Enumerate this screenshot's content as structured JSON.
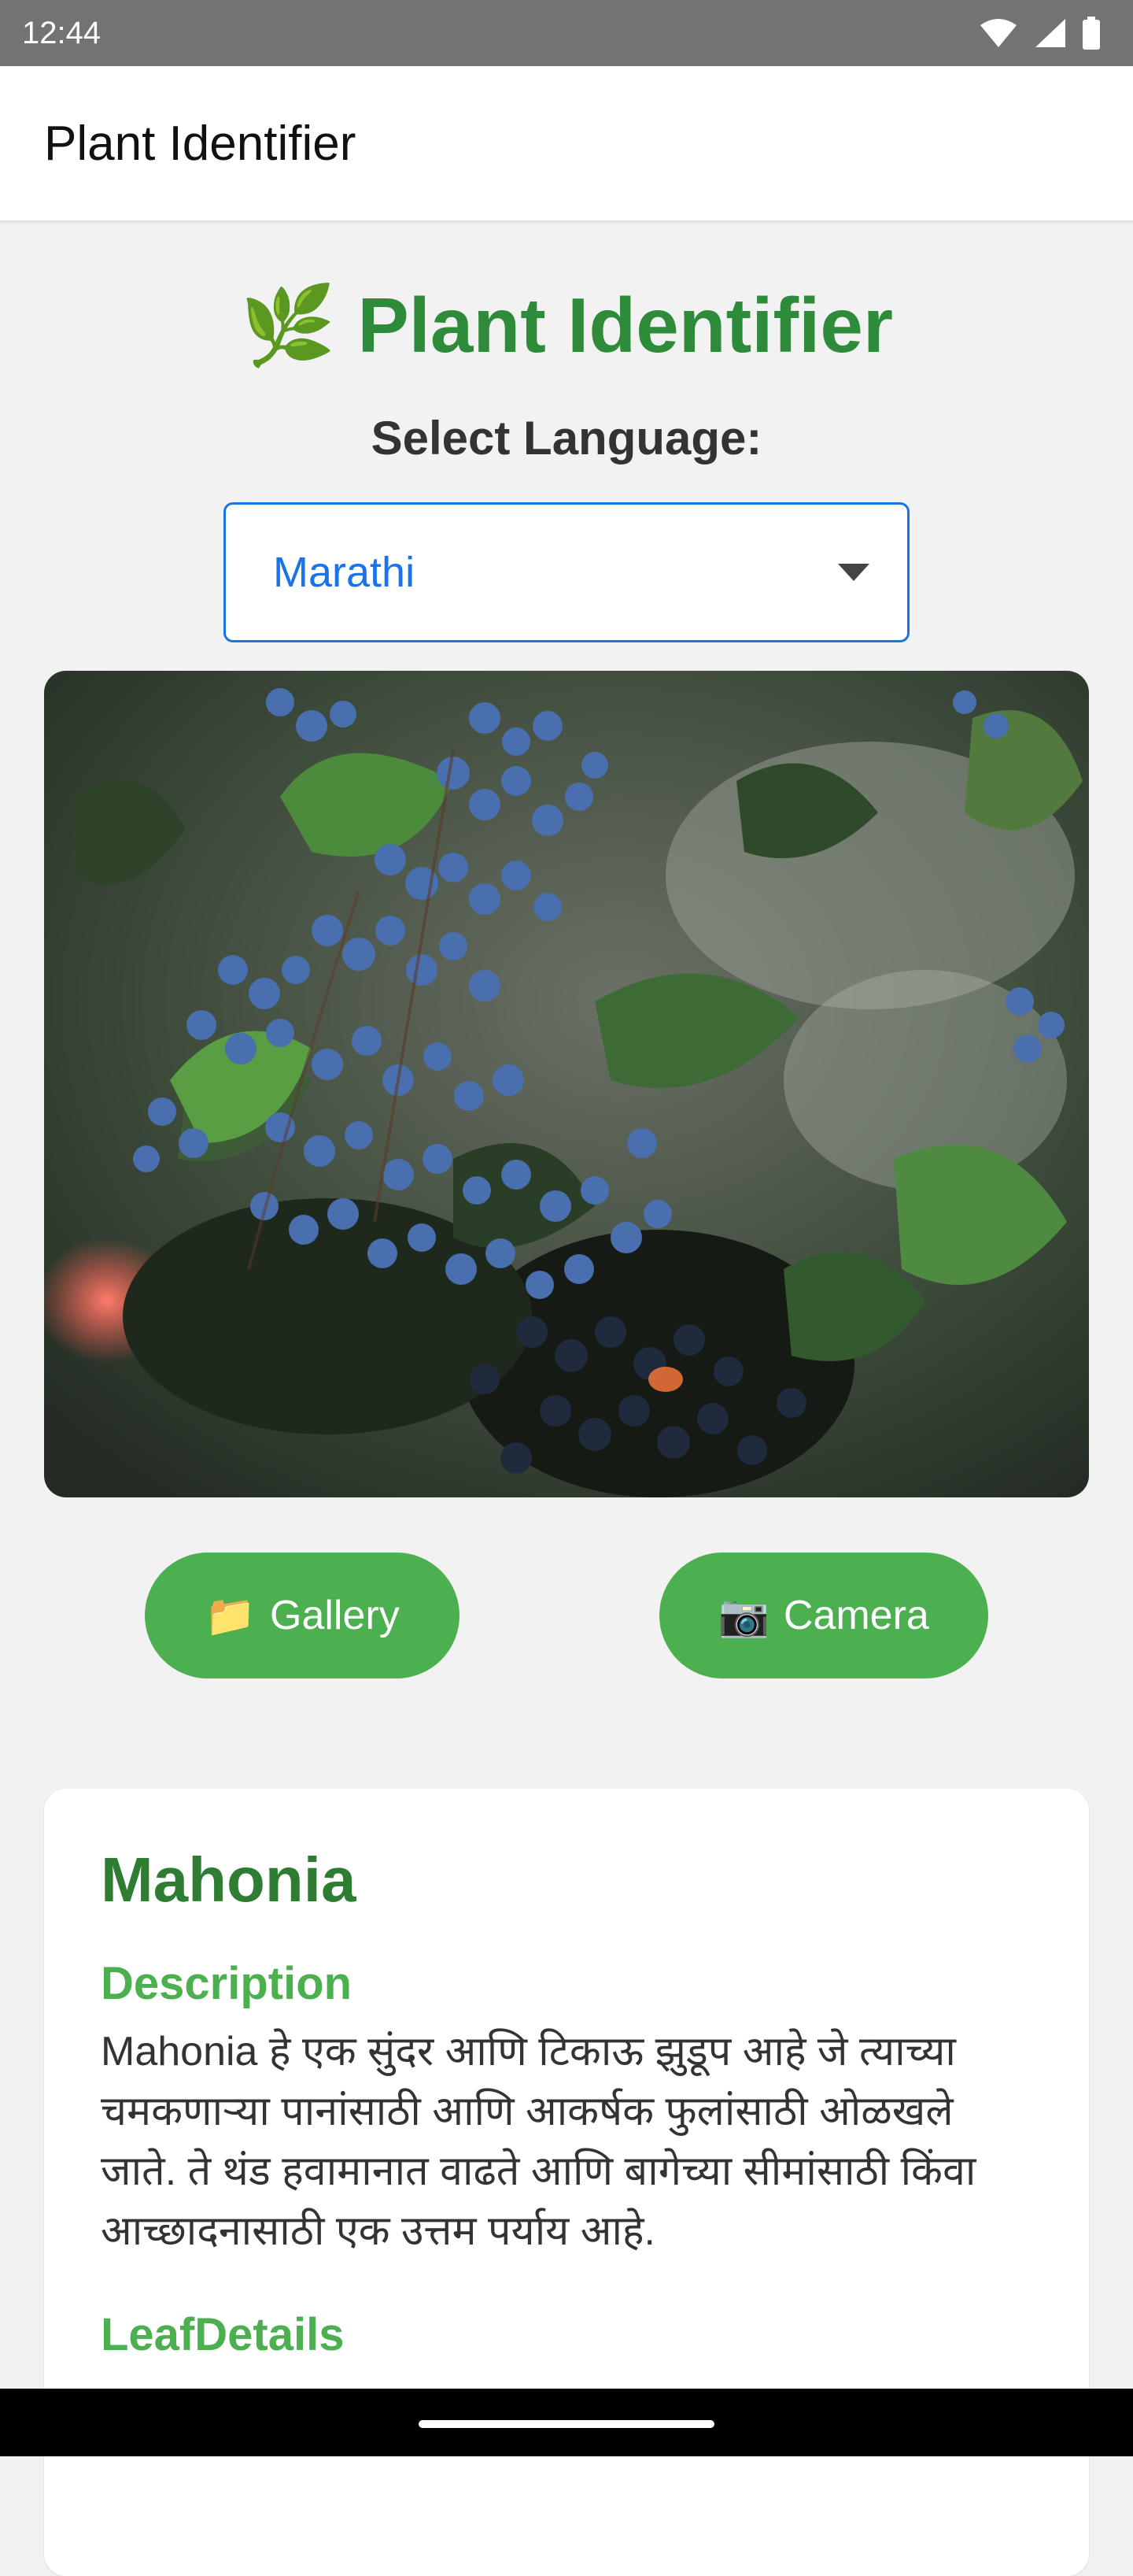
{
  "status_bar": {
    "time": "12:44"
  },
  "app_bar": {
    "title": "Plant Identifier"
  },
  "header": {
    "icon_glyph": "🌿",
    "title": "Plant Identifier"
  },
  "language": {
    "label": "Select Language:",
    "selected": "Marathi"
  },
  "photo": {
    "subject": "Mahonia shrub with clusters of blue berries and holly-like leaves"
  },
  "buttons": {
    "gallery": {
      "icon_glyph": "📁",
      "label": "Gallery"
    },
    "camera": {
      "icon_glyph": "📷",
      "label": "Camera"
    }
  },
  "result": {
    "plant_name": "Mahonia",
    "description_heading": "Description",
    "description_text": "Mahonia हे एक सुंदर आणि टिकाऊ झुडूप आहे जे त्याच्या चमकणाऱ्या पानांसाठी आणि आकर्षक फुलांसाठी ओळखले जाते. ते थंड हवामानात वाढते आणि बागेच्या सीमांसाठी किंवा आच्छादनासाठी एक उत्तम पर्याय आहे.",
    "leaf_heading": "LeafDetails"
  },
  "colors": {
    "status_bar": "#737373",
    "title_green": "#2e8b3a",
    "button_green": "#4caf50",
    "select_blue": "#1a73e8"
  }
}
